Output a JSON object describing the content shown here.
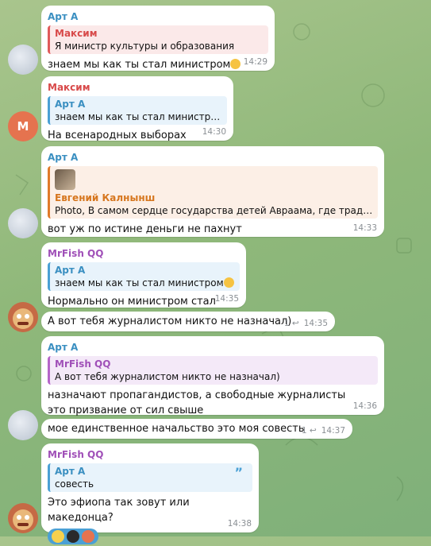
{
  "messages": [
    {
      "sender": "Арт А",
      "reply_name": "Максим",
      "reply_text": "Я министр культуры и образования",
      "text": "знаем мы как ты стал министром",
      "time": "14:29"
    },
    {
      "sender": "Максим",
      "avatar_letter": "М",
      "reply_name": "Арт А",
      "reply_text": "знаем мы как ты стал министром",
      "text": "На всенародных выборах",
      "time": "14:30"
    },
    {
      "sender": "Арт А",
      "reply_name": "Евгений Калнынш",
      "reply_text": "Photo, В самом сердце государства детей Авраама, где традиции …",
      "text": "вот уж по истине деньги не пахнут",
      "time": "14:33"
    },
    {
      "sender": "MrFish QQ",
      "reply_name": "Арт А",
      "reply_text": "знаем мы как ты стал министром",
      "text": "Нормально он министром стал",
      "time": "14:35"
    },
    {
      "text": "А вот тебя журналистом никто не назначал)",
      "reply_count": "1",
      "time": "14:35"
    },
    {
      "sender": "Арт А",
      "reply_name": "MrFish QQ",
      "reply_text": "А вот тебя журналистом никто не назначал)",
      "text": "назначают пропагандистов, а свободные журналисты это призвание от сил свыше",
      "time": "14:36"
    },
    {
      "text": "мое единственное начальство это моя совесть",
      "reply_count": "1",
      "time": "14:37"
    },
    {
      "sender": "MrFish QQ",
      "reply_name": "Арт А",
      "reply_text": "совесть",
      "text": "Это эфиопа так зовут или македонца?",
      "time": "14:38"
    }
  ],
  "colors": {
    "art": "#3a8fc1",
    "maksim": "#d84a4a",
    "mrfish": "#a050b8",
    "reaction": "#4aa0d5"
  }
}
